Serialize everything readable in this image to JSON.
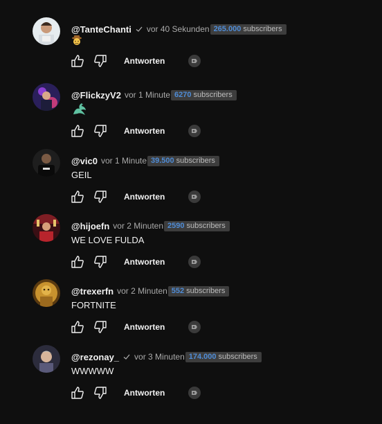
{
  "comments": [
    {
      "handle": "@TanteChanti",
      "verified": true,
      "time": "vor 40 Sekunden",
      "sub_count": "265.000",
      "sub_word": "subscribers",
      "emoji": "cowboy",
      "text": "",
      "reply": "Antworten",
      "avatar_color": "#cfd8dc"
    },
    {
      "handle": "@FlickzyV2",
      "verified": false,
      "time": "vor 1 Minute",
      "sub_count": "6270",
      "sub_word": "subscribers",
      "emoji": "dragon",
      "text": "",
      "reply": "Antworten",
      "avatar_color": "#3a2a6e"
    },
    {
      "handle": "@vic0",
      "verified": false,
      "time": "vor 1 Minute",
      "sub_count": "39.500",
      "sub_word": "subscribers",
      "emoji": "",
      "text": "GEIL",
      "reply": "Antworten",
      "avatar_color": "#2b2b2b"
    },
    {
      "handle": "@hijoefn",
      "verified": false,
      "time": "vor 2 Minuten",
      "sub_count": "2590",
      "sub_word": "subscribers",
      "emoji": "",
      "text": "WE LOVE FULDA",
      "reply": "Antworten",
      "avatar_color": "#7a1c1c"
    },
    {
      "handle": "@trexerfn",
      "verified": false,
      "time": "vor 2 Minuten",
      "sub_count": "552",
      "sub_word": "subscribers",
      "emoji": "",
      "text": "FORTNITE",
      "reply": "Antworten",
      "avatar_color": "#b8862b"
    },
    {
      "handle": "@rezonay_",
      "verified": true,
      "time": "vor 3 Minuten",
      "sub_count": "174.000",
      "sub_word": "subscribers",
      "emoji": "",
      "text": "WWWWW",
      "reply": "Antworten",
      "avatar_color": "#4a4a6a"
    }
  ],
  "colors": {
    "background": "#0f0f0f",
    "badge_bg": "#3d3d3d",
    "badge_count": "#4f8cd6",
    "muted": "#aaaaaa"
  }
}
